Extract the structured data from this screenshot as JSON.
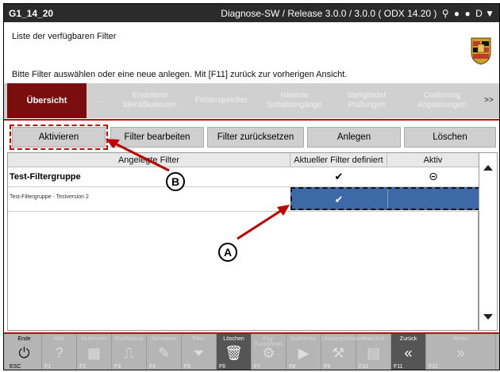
{
  "titlebar": {
    "id": "G1_14_20",
    "status": "Diagnose-SW / Release 3.0.0 / 3.0.0  ( ODX  14.20 )",
    "icons": [
      "filter-icon",
      "record-icon",
      "record-icon"
    ],
    "lang": "D ▼"
  },
  "info": {
    "line1": "Liste der verfügbaren Filter",
    "line2": "Bitte Filter auswählen oder eine neue anlegen. Mit [F11] zurück zur vorherigen Ansicht."
  },
  "nav": {
    "tabs": [
      "Übersicht",
      "...",
      "Erweiterte Identifikationen",
      "Fehlerspeicher",
      "Istwerte Schalteingänge",
      "Stellglieder Prüfungen",
      "Codierung Anpassungen",
      ">>"
    ]
  },
  "toolbar": {
    "activate": "Aktivieren",
    "edit": "Filter bearbeiten",
    "reset": "Filter zurücksetzen",
    "create": "Anlegen",
    "delete": "Löschen"
  },
  "table": {
    "headers": [
      "Angelegte Filter",
      "Aktueller Filter definiert",
      "Aktiv"
    ],
    "rows": [
      {
        "name": "Test-Filtergruppe",
        "defined": "✔",
        "active": "⊝"
      },
      {
        "name": "Test-Filtergruppe - Testversion 2",
        "defined": "✔",
        "active": ""
      }
    ]
  },
  "annotations": {
    "a": "A",
    "b": "B"
  },
  "fkeys": [
    {
      "label": "Ende",
      "key": "ESC",
      "icon": "power-icon",
      "enabled": true
    },
    {
      "label": "Hilfe",
      "key": "F1",
      "icon": "help-icon",
      "enabled": false
    },
    {
      "label": "Multimeter",
      "key": "F2",
      "icon": "multimeter-icon",
      "enabled": false
    },
    {
      "label": "Oszilloskop",
      "key": "F3",
      "icon": "oscilloscope-icon",
      "enabled": false
    },
    {
      "label": "Schreiben",
      "key": "F4",
      "icon": "write-icon",
      "enabled": false
    },
    {
      "label": "Filter",
      "key": "F5",
      "icon": "filter-icon",
      "enabled": false
    },
    {
      "label": "Löschen",
      "key": "F6",
      "icon": "delete-icon",
      "enabled": true,
      "dark": true
    },
    {
      "label": "Fzg-Funktionen",
      "key": "F7",
      "icon": "vehicle-icon",
      "enabled": false
    },
    {
      "label": "Ausführen",
      "key": "F8",
      "icon": "play-icon",
      "enabled": false
    },
    {
      "label": "Leistungsfunktionen",
      "key": "F9",
      "icon": "service-icon",
      "enabled": false
    },
    {
      "label": "Protokoll",
      "key": "F10",
      "icon": "protocol-icon",
      "enabled": false
    },
    {
      "label": "Zurück",
      "key": "F11",
      "icon": "back-icon",
      "enabled": true,
      "dark": true
    },
    {
      "label": "Weiter",
      "key": "F12",
      "icon": "forward-icon",
      "enabled": false
    }
  ]
}
